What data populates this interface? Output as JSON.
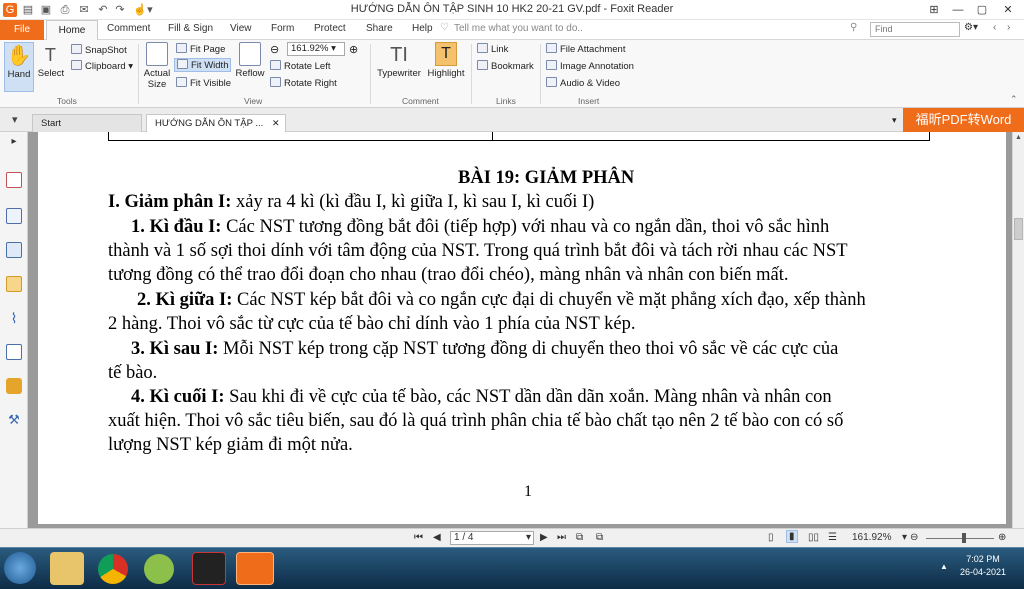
{
  "window": {
    "title": "HƯỚNG DẪN ÔN TẬP SINH 10 HK2 20-21 GV.pdf - Foxit Reader",
    "controls": [
      "▭",
      "—",
      "▢",
      "✕"
    ]
  },
  "menu": {
    "file": "File",
    "home": "Home",
    "items": [
      "Comment",
      "Fill & Sign",
      "View",
      "Form",
      "Protect",
      "Share",
      "Help"
    ],
    "tell_me": "Tell me what you want to do..",
    "find_placeholder": "Find"
  },
  "ribbon": {
    "tools": {
      "hand": "Hand",
      "select": "Select",
      "snapshot": "SnapShot",
      "clipboard": "Clipboard",
      "group": "Tools"
    },
    "view": {
      "actual_size_1": "Actual",
      "actual_size_2": "Size",
      "fit_page": "Fit Page",
      "fit_width": "Fit Width",
      "fit_visible": "Fit Visible",
      "reflow": "Reflow",
      "zoom": "161.92%",
      "rotate_left": "Rotate Left",
      "rotate_right": "Rotate Right",
      "group": "View"
    },
    "comment": {
      "typewriter": "Typewriter",
      "highlight": "Highlight",
      "group": "Comment"
    },
    "links": {
      "link": "Link",
      "bookmark": "Bookmark",
      "group": "Links"
    },
    "insert": {
      "file_attachment": "File Attachment",
      "image_annotation": "Image Annotation",
      "audio_video": "Audio & Video",
      "group": "Insert"
    }
  },
  "tabs": {
    "start": "Start",
    "document": "HƯỚNG DẪN ÔN TẬP ...",
    "convert": "福昕PDF转Word"
  },
  "document": {
    "heading": "BÀI 19:  GIẢM PHÂN",
    "section_title": "I. Giảm phân I:",
    "section_text": " xảy ra 4 kì (kì đầu I, kì giữa I, kì sau I, kì cuối I)",
    "p1_title": "1. Kì đầu I:",
    "p1_l1": " Các NST tương đồng bắt đôi (tiếp hợp) với nhau và co ngắn dần, thoi vô sắc hình",
    "p1_l2": "thành và 1 số sợi thoi dính với tâm động của NST. Trong quá trình bắt đôi và tách rời nhau các NST",
    "p1_l3": "tương đồng có thể trao đổi đoạn cho nhau (trao đổi chéo), màng nhân và nhân con biến mất.",
    "p2_title": "2. Kì giữa I:",
    "p2_l1": " Các NST kép bắt đôi và co ngắn cực đại di chuyển về mặt phẳng xích đạo, xếp thành",
    "p2_l2": "2 hàng. Thoi vô sắc từ cực của tế bào chỉ dính vào 1 phía của NST kép.",
    "p3_title": "3. Kì sau I:",
    "p3_l1": " Mỗi NST kép trong cặp NST tương đồng di chuyển theo thoi vô sắc về các cực của",
    "p3_l2": "tế bào.",
    "p4_title": "4. Kì cuối I:",
    "p4_l1": " Sau khi đi về cực của tế bào, các NST dần dần dãn xoắn. Màng nhân và nhân con",
    "p4_l2": "xuất hiện. Thoi vô sắc tiêu biến, sau đó là quá trình phân chia tế bào chất tạo nên 2 tế bào con có số",
    "p4_l3": "lượng NST kép giảm đi một nửa.",
    "page_number": "1"
  },
  "status": {
    "page": "1 / 4",
    "zoom": "161.92%"
  },
  "taskbar": {
    "time": "7:02 PM",
    "date": "26-04-2021"
  },
  "colors": {
    "accent": "#ef6c1a",
    "taskbar": "#1b4466"
  }
}
